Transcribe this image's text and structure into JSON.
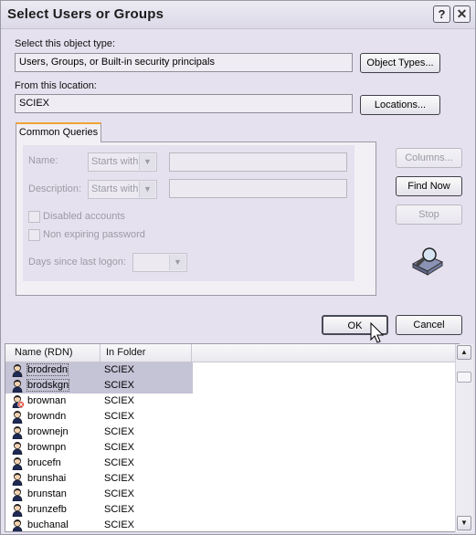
{
  "window": {
    "title": "Select Users or Groups",
    "help_glyph": "?",
    "close_glyph": "✕"
  },
  "object_type": {
    "label": "Select this object type:",
    "value": "Users, Groups, or Built-in security principals",
    "button": "Object Types..."
  },
  "location": {
    "label": "From this location:",
    "value": "SCIEX",
    "button": "Locations..."
  },
  "common_queries": {
    "tab_label": "Common Queries",
    "name_label": "Name:",
    "name_mode": "Starts with",
    "description_label": "Description:",
    "description_mode": "Starts with",
    "disabled_accounts_label": "Disabled accounts",
    "non_expiring_label": "Non expiring password",
    "days_since_logon_label": "Days since last logon:"
  },
  "side_buttons": {
    "columns": "Columns...",
    "find_now": "Find Now",
    "stop": "Stop"
  },
  "dialog_buttons": {
    "ok": "OK",
    "cancel": "Cancel"
  },
  "results": {
    "columns": [
      "Name (RDN)",
      "In Folder"
    ],
    "rows": [
      {
        "name": "brodredn",
        "folder": "SCIEX",
        "selected": true,
        "icon": "user-icon"
      },
      {
        "name": "brodskgn",
        "folder": "SCIEX",
        "selected": true,
        "icon": "user-icon"
      },
      {
        "name": "brownan",
        "folder": "SCIEX",
        "selected": false,
        "icon": "disabled-user-icon"
      },
      {
        "name": "browndn",
        "folder": "SCIEX",
        "selected": false,
        "icon": "user-icon"
      },
      {
        "name": "brownejn",
        "folder": "SCIEX",
        "selected": false,
        "icon": "user-icon"
      },
      {
        "name": "brownpn",
        "folder": "SCIEX",
        "selected": false,
        "icon": "user-icon"
      },
      {
        "name": "brucefn",
        "folder": "SCIEX",
        "selected": false,
        "icon": "user-icon"
      },
      {
        "name": "brunshai",
        "folder": "SCIEX",
        "selected": false,
        "icon": "user-icon"
      },
      {
        "name": "brunstan",
        "folder": "SCIEX",
        "selected": false,
        "icon": "user-icon"
      },
      {
        "name": "brunzefb",
        "folder": "SCIEX",
        "selected": false,
        "icon": "user-icon"
      },
      {
        "name": "buchanal",
        "folder": "SCIEX",
        "selected": false,
        "icon": "user-icon"
      }
    ]
  }
}
